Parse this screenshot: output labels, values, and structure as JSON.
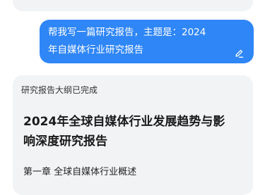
{
  "conversation": {
    "user_message": {
      "line1": "帮我写一篇研究报告，主题是：2024",
      "line2": "年自媒体行业研究报告",
      "action_icon": "edit-icon"
    },
    "ai_response": {
      "status": "研究报告大纲已完成",
      "title_line1": "2024年全球自媒体行业发展趋势与影",
      "title_line2": "响深度研究报告",
      "chapter1": "第一章  全球自媒体行业概述"
    }
  },
  "colors": {
    "user_bubble": "#2f86f6",
    "card_background": "#f2f3f5",
    "primary_text": "#1a1a1a"
  }
}
